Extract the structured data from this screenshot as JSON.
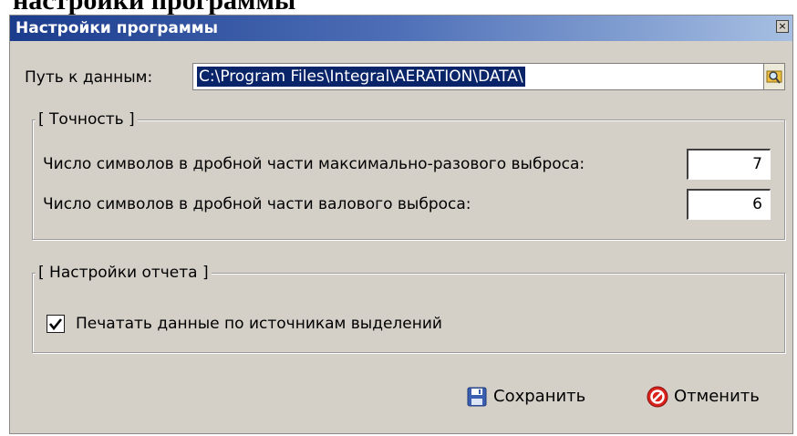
{
  "background_heading": "настройки программы",
  "window": {
    "title": "Настройки программы",
    "close_glyph": "×"
  },
  "data_path": {
    "label": "Путь к данным:",
    "value": "C:\\Program Files\\Integral\\AERATION\\DATA\\",
    "browse_icon": "folder-search-icon"
  },
  "precision_group": {
    "caption": "[ Точность ]",
    "max_label": "Число символов в дробной части максимально-разового выброса:",
    "max_value": "7",
    "gross_label": "Число символов в дробной части валового выброса:",
    "gross_value": "6"
  },
  "report_group": {
    "caption": "[ Настройки отчета ]",
    "print_sources_label": "Печатать данные по источникам выделений",
    "print_sources_checked": true
  },
  "actions": {
    "save_label": "Сохранить",
    "save_icon": "floppy-disk-icon",
    "cancel_label": "Отменить",
    "cancel_icon": "cancel-circle-icon"
  },
  "colors": {
    "title_bar_start": "#1b3c8c",
    "title_bar_end": "#a6bfe2",
    "dialog_bg": "#d4d0c8",
    "selection_bg": "#0a246a",
    "cancel_red": "#d9221c",
    "save_blue": "#3a5fb0"
  }
}
